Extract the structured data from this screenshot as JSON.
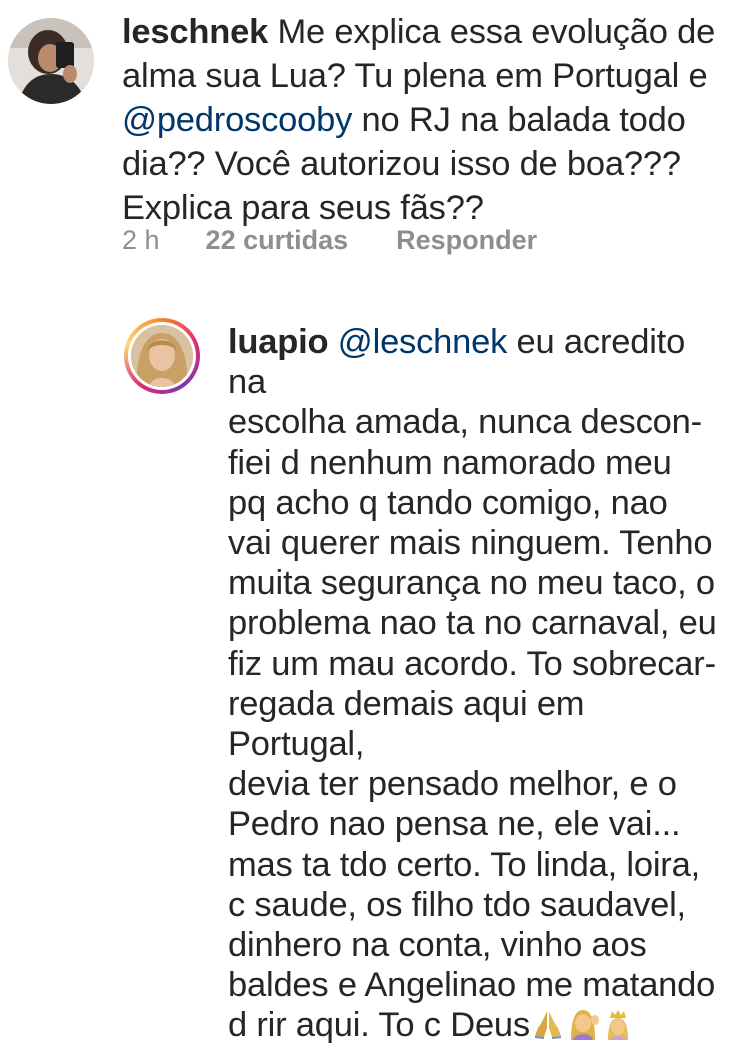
{
  "comment": {
    "username": "leschnek",
    "text_before": " Me explica essa evolução de alma sua Lua? Tu plena em Portugal e ",
    "mention": "@pedroscooby",
    "text_after": " no RJ na balada todo dia?? Você autorizou isso de boa??? Explica para seus fãs??",
    "time": "2 h",
    "likes": "22 curtidas",
    "reply_label": "Responder"
  },
  "reply": {
    "username": "luapio",
    "mention": "@leschnek",
    "lines": [
      " eu acredito na",
      "escolha amada, nunca descon-",
      "fiei d nenhum namorado meu",
      "pq acho q tando comigo, nao",
      "vai querer mais ninguem. Tenho",
      "muita segurança no meu taco, o",
      "problema nao ta no carnaval, eu",
      "fiz um mau acordo. To sobrecar-",
      "regada demais aqui em Portugal,",
      "devia ter pensado melhor, e o",
      "Pedro nao pensa ne, ele vai...",
      "mas ta tdo certo. To linda, loira,",
      "c saude, os filho tdo saudavel,",
      "dinhero na conta, vinho aos",
      "baldes e Angelinao me matando",
      "d rir aqui. To c Deus"
    ],
    "emojis": [
      "folded-hands",
      "woman-tipping-hand",
      "person-with-crown"
    ]
  },
  "colors": {
    "text": "#262626",
    "meta": "#8e8e8e",
    "mention": "#00376b"
  }
}
